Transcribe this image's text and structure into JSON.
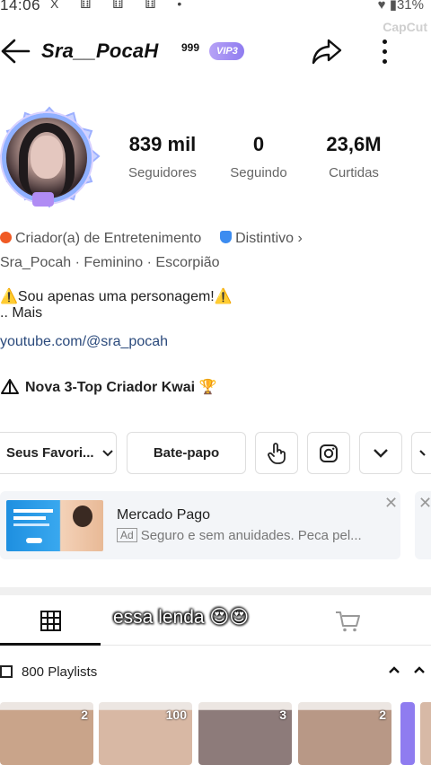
{
  "status_bar": {
    "time": "14:06",
    "left_icons": "X ⚅ ⚅ ⚅ •",
    "right": "♥ ▮31%"
  },
  "watermark": "CapCut",
  "header": {
    "username": "Sra__PocaH",
    "superscript": "999",
    "vip_badge": "VIP3"
  },
  "stats": [
    {
      "value": "839 mil",
      "label": "Seguidores"
    },
    {
      "value": "0",
      "label": "Seguindo"
    },
    {
      "value": "23,6M",
      "label": "Curtidas"
    }
  ],
  "profile": {
    "category": "Criador(a) de Entretenimento",
    "distinction": "Distintivo",
    "tags": "Sra_Pocah  ·  Feminino  ·  Escorpião",
    "bio_line1": "⚠️Sou apenas uma personagem!⚠️",
    "bio_more": "..  Mais",
    "link": "youtube.com/@sra_pocah",
    "ranking": "Nova 3-Top Criador Kwai 🏆"
  },
  "actions": {
    "favorites": "Seus Favori...",
    "chat": "Bate-papo"
  },
  "ad": {
    "title": "Mercado Pago",
    "tag": "Ad",
    "subtitle": "Seguro e sem anuidades. Peca pel..."
  },
  "tabs": {
    "caption_overlay": "essa lenda 😍😍"
  },
  "playlists": {
    "label": "800 Playlists"
  },
  "thumbnails": [
    {
      "count": "2",
      "color": "#c9a48a"
    },
    {
      "count": "100",
      "color": "#d8b8a4"
    },
    {
      "count": "3",
      "color": "#8d7b7a"
    },
    {
      "count": "2",
      "color": "#b89886"
    }
  ],
  "colors": {
    "vip": "#9c88f2",
    "link": "#2b4a7c",
    "ad_background": "#f3f5f8"
  }
}
